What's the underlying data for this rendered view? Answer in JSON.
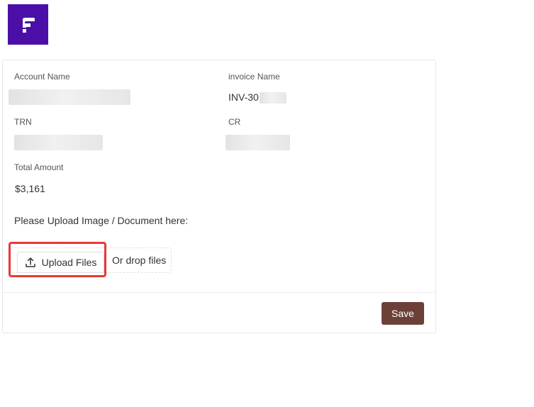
{
  "logo": {
    "icon": "brand-logo-icon",
    "color": "#4b0fa8"
  },
  "form": {
    "account_name": {
      "label": "Account Name",
      "value": ""
    },
    "invoice_name": {
      "label": "invoice Name",
      "value_prefix": "INV-30"
    },
    "trn": {
      "label": "TRN",
      "value": ""
    },
    "cr": {
      "label": "CR",
      "value": ""
    },
    "total_amount": {
      "label": "Total Amount",
      "value": "$3,161"
    }
  },
  "upload": {
    "prompt": "Please Upload Image / Document here:",
    "button_label": "Upload Files",
    "drop_text": "Or drop files",
    "highlight_color": "#e53935"
  },
  "actions": {
    "save_label": "Save",
    "save_color": "#6b4137"
  }
}
